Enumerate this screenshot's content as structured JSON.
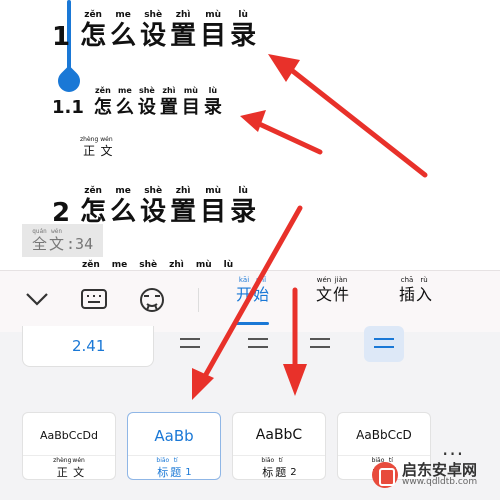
{
  "document": {
    "heading1": {
      "number": "1",
      "chars": [
        "怎",
        "么",
        "设",
        "置",
        "目",
        "录"
      ],
      "pinyin": [
        "zěn",
        "me",
        "shè",
        "zhì",
        "mù",
        "lù"
      ]
    },
    "heading2": {
      "number": "1.1",
      "chars": [
        "怎",
        "么",
        "设",
        "置",
        "目",
        "录"
      ],
      "pinyin": [
        "zěn",
        "me",
        "shè",
        "zhì",
        "mù",
        "lù"
      ]
    },
    "body_text": {
      "chars": [
        "正",
        "文"
      ],
      "pinyin": [
        "zhèng",
        "wén"
      ]
    },
    "heading3": {
      "number": "2",
      "chars": [
        "怎",
        "么",
        "设",
        "置",
        "目",
        "录"
      ],
      "pinyin": [
        "zěn",
        "me",
        "shè",
        "zhì",
        "mù",
        "lù"
      ]
    },
    "partial_heading_pinyin": [
      "zěn",
      "me",
      "shè",
      "zhì",
      "mù",
      "lù"
    ]
  },
  "word_count": {
    "label_chars": [
      "全",
      "文"
    ],
    "label_pinyin": [
      "quán",
      "wén"
    ],
    "value": ":34"
  },
  "toolbar": {
    "tabs": [
      {
        "chars": [
          "开",
          "始"
        ],
        "pinyin": [
          "kāi",
          "shǐ"
        ],
        "active": true
      },
      {
        "chars": [
          "文",
          "件"
        ],
        "pinyin": [
          "wén",
          "jiàn"
        ],
        "active": false
      },
      {
        "chars": [
          "插",
          "入"
        ],
        "pinyin": [
          "chā",
          "rù"
        ],
        "active": false
      }
    ]
  },
  "format": {
    "font_size": "2.41"
  },
  "styles": [
    {
      "sample": "AaBbCcDd",
      "chars": [
        "正",
        "文"
      ],
      "pinyin": [
        "zhèng",
        "wén"
      ],
      "num": ""
    },
    {
      "sample": "AaBb",
      "chars": [
        "标",
        "题"
      ],
      "pinyin": [
        "biāo",
        "tí"
      ],
      "num": "1"
    },
    {
      "sample": "AaBbC",
      "chars": [
        "标",
        "题"
      ],
      "pinyin": [
        "biāo",
        "tí"
      ],
      "num": "2"
    },
    {
      "sample": "AaBbCcD",
      "chars": [
        "标",
        "题"
      ],
      "pinyin": [
        "biāo",
        "tí"
      ],
      "num": ""
    }
  ],
  "more_label": "...",
  "watermark": {
    "title": "启东安卓网",
    "url": "www.qdldtb.com"
  },
  "colors": {
    "accent": "#1a78d6",
    "arrow": "#e8312a"
  }
}
